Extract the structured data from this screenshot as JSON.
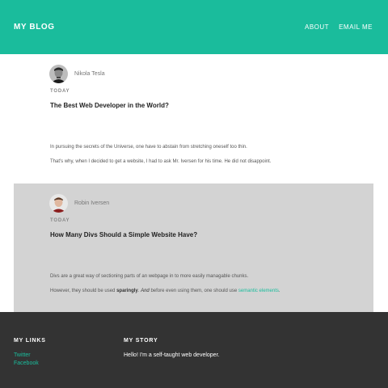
{
  "header": {
    "brand": "MY BLOG",
    "nav": [
      {
        "label": "ABOUT"
      },
      {
        "label": "EMAIL ME"
      }
    ],
    "color": "#1abc9c"
  },
  "posts": [
    {
      "author": "Nikola Tesla",
      "date": "TODAY",
      "title": "The Best Web Developer in the World?",
      "p1": "In pursuing the secrets of the Universe, one have to abstain from stretching oneself too thin.",
      "p2": "That's why, when I decided to get a website, I had to ask Mr. Iversen for his time. He did not disappoint."
    },
    {
      "author": "Robin Iversen",
      "date": "TODAY",
      "title": "How Many Divs Should a Simple Website Have?",
      "p1": "Divs are a great way of sectioning parts of an webpage in to more easily managable chunks.",
      "p2_a": "However, they should be used ",
      "p2_b": "sparingly",
      "p2_c": ". ",
      "p2_d": "And",
      "p2_e": " before even using them, one should use ",
      "p2_link": "semantic elements",
      "p2_f": "."
    }
  ],
  "footer": {
    "links_heading": "MY LINKS",
    "links": [
      {
        "label": "Twitter"
      },
      {
        "label": "Facebook"
      }
    ],
    "story_heading": "MY STORY",
    "story_text": "Hello! I'm a self-taught web developer."
  }
}
